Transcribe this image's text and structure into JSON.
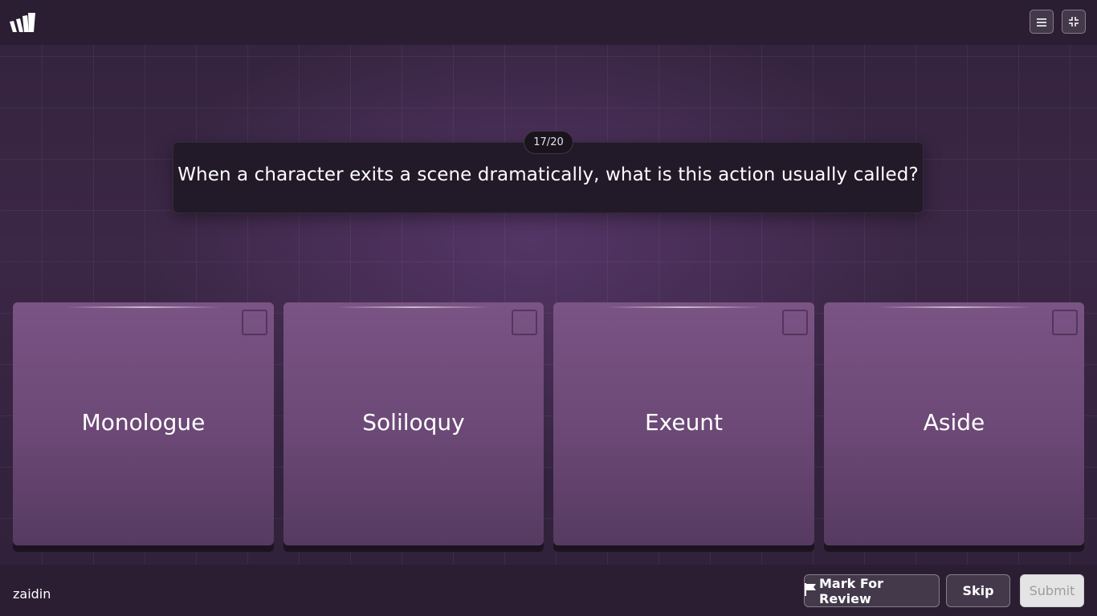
{
  "header": {
    "logo_icon": "quizizz-logo-icon",
    "menu_icon": "hamburger-menu-icon",
    "exit_fullscreen_icon": "exit-fullscreen-icon"
  },
  "question": {
    "counter": "17/20",
    "text": "When a character exits a scene dramatically, what is this action usually called?"
  },
  "options": [
    {
      "label": "Monologue"
    },
    {
      "label": "Soliloquy"
    },
    {
      "label": "Exeunt"
    },
    {
      "label": "Aside"
    }
  ],
  "footer": {
    "username": "zaidin",
    "mark_review_label": "Mark For Review",
    "mark_review_icon": "flag-icon",
    "skip_label": "Skip",
    "submit_label": "Submit"
  },
  "colors": {
    "background": "#2e1f36",
    "option_card": "#6b4875",
    "question_card": "#231a29"
  }
}
